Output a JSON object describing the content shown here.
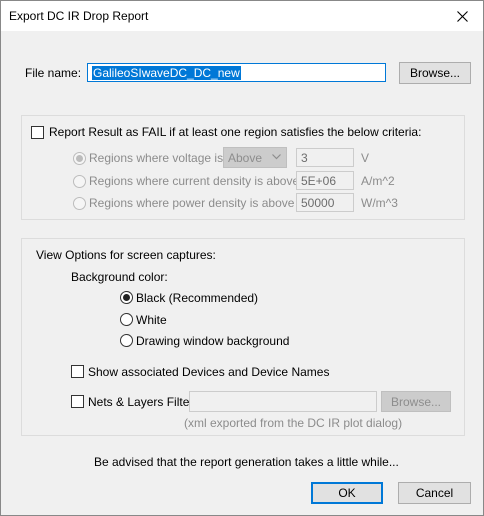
{
  "window": {
    "title": "Export DC IR Drop Report"
  },
  "file": {
    "label": "File name:",
    "value": "GalileoSIwaveDC_DC_new",
    "browse_label": "Browse..."
  },
  "criteria": {
    "checkbox_label": "Report Result as FAIL if at least one region satisfies the below criteria:",
    "checked": false,
    "voltage": {
      "label": "Regions where voltage is",
      "selected": true,
      "comparator": "Above",
      "value": "3",
      "unit": "V"
    },
    "current": {
      "label": "Regions where current density is above",
      "selected": false,
      "value": "5E+06",
      "unit": "A/m^2"
    },
    "power": {
      "label": "Regions where power density is above",
      "selected": false,
      "value": "50000",
      "unit": "W/m^3"
    }
  },
  "view": {
    "group_label": "View Options for screen captures:",
    "bg_label": "Background color:",
    "bg_options": [
      {
        "label": "Black (Recommended)",
        "selected": true
      },
      {
        "label": "White",
        "selected": false
      },
      {
        "label": "Drawing window background",
        "selected": false
      }
    ],
    "show_devices_label": "Show associated Devices and Device Names",
    "nets_label": "Nets & Layers Filter:",
    "nets_value": "",
    "nets_browse_label": "Browse...",
    "nets_hint": "(xml exported from the DC IR plot dialog)"
  },
  "footer": {
    "advice": "Be advised that the report generation takes a little while...",
    "ok_label": "OK",
    "cancel_label": "Cancel"
  }
}
